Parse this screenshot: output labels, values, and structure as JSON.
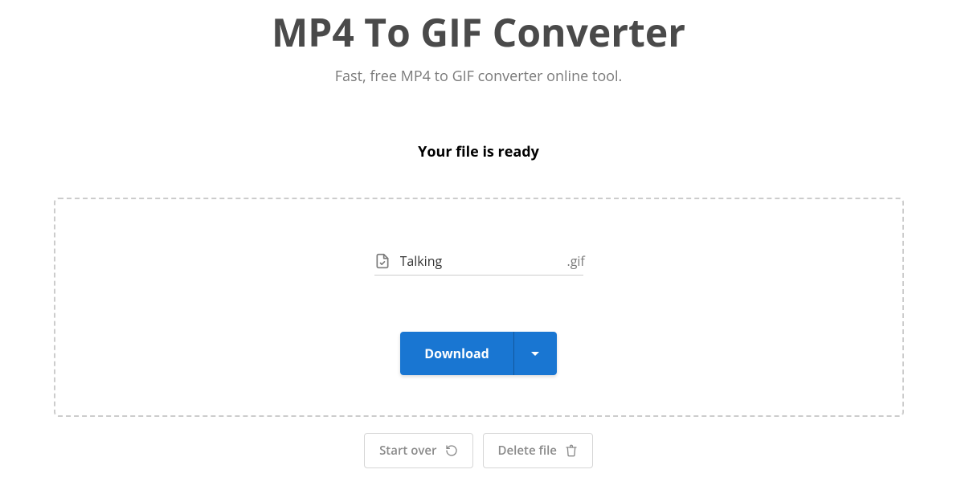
{
  "header": {
    "title": "MP4 To GIF Converter",
    "subtitle": "Fast, free MP4 to GIF converter online tool."
  },
  "status": {
    "heading": "Your file is ready"
  },
  "file": {
    "name": "Talking",
    "extension": ".gif"
  },
  "download": {
    "label": "Download"
  },
  "actions": {
    "start_over": "Start over",
    "delete_file": "Delete file"
  },
  "colors": {
    "primary": "#1976d2"
  }
}
